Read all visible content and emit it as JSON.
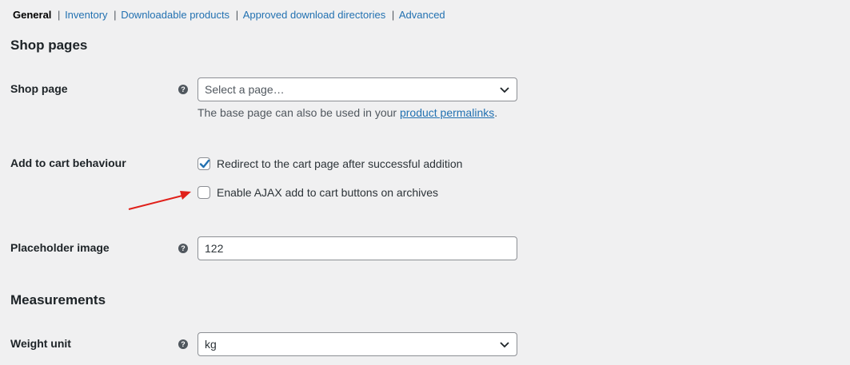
{
  "tabs": {
    "general": "General",
    "inventory": "Inventory",
    "downloadable": "Downloadable products",
    "approved": "Approved download directories",
    "advanced": "Advanced",
    "separator": "|"
  },
  "sections": {
    "shop_pages": "Shop pages",
    "measurements": "Measurements"
  },
  "shop_page": {
    "label": "Shop page",
    "placeholder": "Select a page…",
    "desc_prefix": "The base page can also be used in your ",
    "desc_link": "product permalinks",
    "desc_suffix": "."
  },
  "add_to_cart": {
    "label": "Add to cart behaviour",
    "options": [
      {
        "label": "Redirect to the cart page after successful addition",
        "checked": true
      },
      {
        "label": "Enable AJAX add to cart buttons on archives",
        "checked": false
      }
    ]
  },
  "placeholder_image": {
    "label": "Placeholder image",
    "value": "122"
  },
  "weight_unit": {
    "label": "Weight unit",
    "value": "kg"
  },
  "help_icon_glyph": "?",
  "colors": {
    "link": "#2271b1",
    "checkbox_check": "#2271b1",
    "annotation_arrow": "#e0201a",
    "background": "#f0f0f1"
  }
}
